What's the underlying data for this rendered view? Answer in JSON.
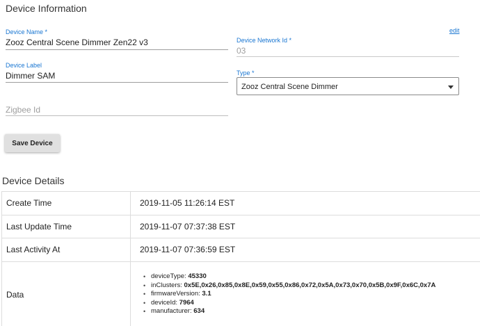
{
  "device_info": {
    "title": "Device Information",
    "edit_link": "edit",
    "device_name": {
      "label": "Device Name *",
      "value": "Zooz Central Scene Dimmer Zen22 v3"
    },
    "device_network_id": {
      "label": "Device Network Id *",
      "value": "03"
    },
    "device_label": {
      "label": "Device Label",
      "value": "Dimmer SAM"
    },
    "type": {
      "label": "Type *",
      "value": "Zooz Central Scene Dimmer"
    },
    "zigbee_id": {
      "placeholder": "Zigbee Id"
    },
    "save_button": "Save Device"
  },
  "device_details": {
    "title": "Device Details",
    "rows": [
      {
        "key": "Create Time",
        "value": "2019-11-05 11:26:14 EST"
      },
      {
        "key": "Last Update Time",
        "value": "2019-11-07 07:37:38 EST"
      },
      {
        "key": "Last Activity At",
        "value": "2019-11-07 07:36:59 EST"
      }
    ],
    "data": {
      "key": "Data",
      "items": [
        {
          "name": "deviceType:",
          "value": "45330"
        },
        {
          "name": "inClusters:",
          "value": "0x5E,0x26,0x85,0x8E,0x59,0x55,0x86,0x72,0x5A,0x73,0x70,0x5B,0x9F,0x6C,0x7A"
        },
        {
          "name": "firmwareVersion:",
          "value": "3.1"
        },
        {
          "name": "deviceId:",
          "value": "7964"
        },
        {
          "name": "manufacturer:",
          "value": "634"
        }
      ]
    }
  }
}
